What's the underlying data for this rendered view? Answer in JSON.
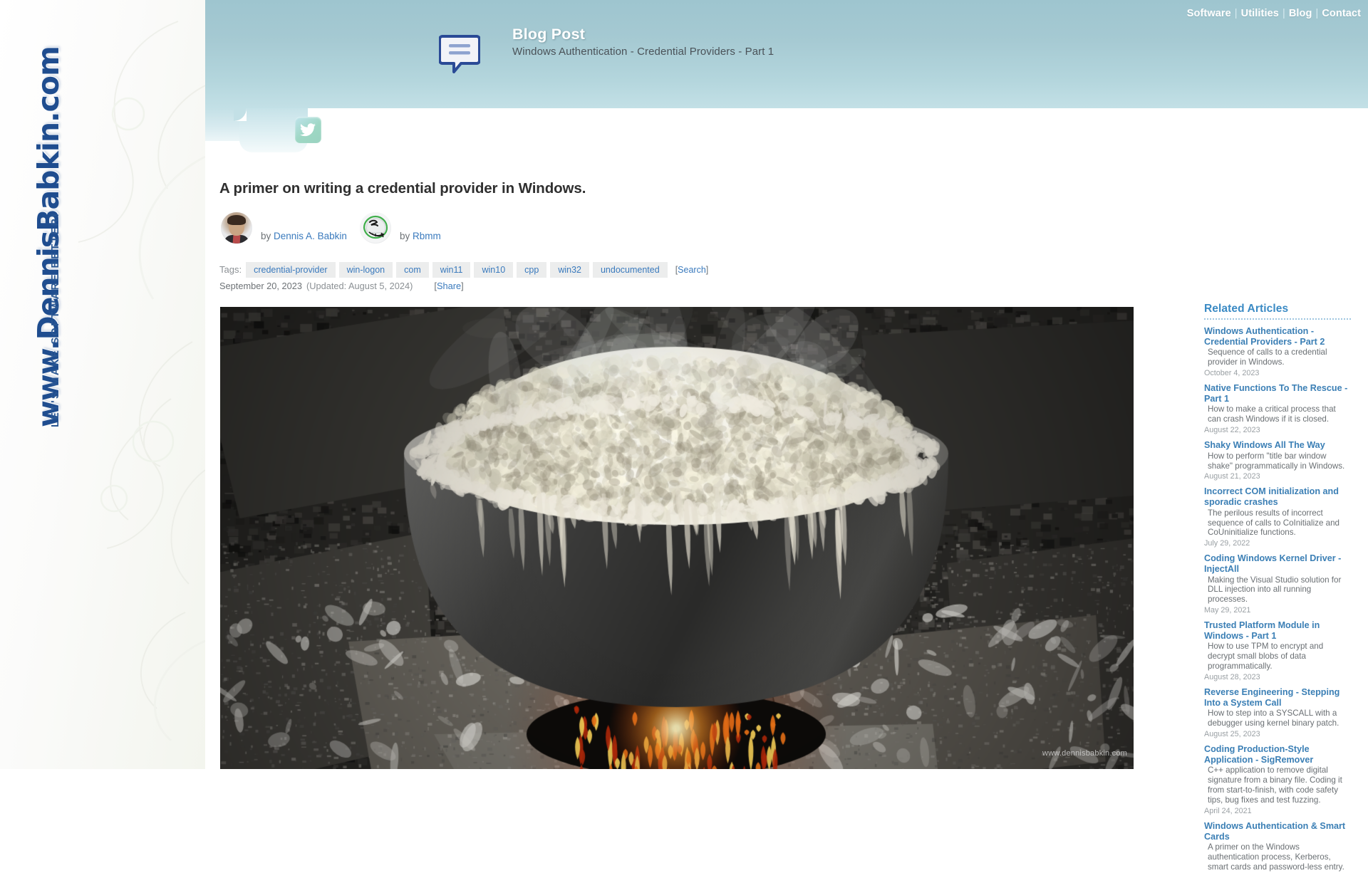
{
  "brand": {
    "url_text": "www.DennisBabkin.com",
    "tagline": "LET'S MAKE SOFTWARE BETTER!"
  },
  "nav": {
    "items": [
      {
        "label": "Software"
      },
      {
        "label": "Utilities"
      },
      {
        "label": "Blog"
      },
      {
        "label": "Contact"
      }
    ],
    "separator": "|"
  },
  "header": {
    "icon_name": "speech-bubble-icon",
    "title": "Blog Post",
    "subtitle": "Windows Authentication - Credential Providers - Part 1"
  },
  "tabs": {
    "twitter_icon_name": "twitter-bird-icon"
  },
  "article": {
    "title": "A primer on writing a credential provider in Windows.",
    "authors": [
      {
        "by_label": "by",
        "name": "Dennis A. Babkin",
        "avatar_name": "avatar-dennis-babkin"
      },
      {
        "by_label": "by",
        "name": "Rbmm",
        "avatar_name": "avatar-rbmm-helmet"
      }
    ],
    "tags_label": "Tags:",
    "tags": [
      "credential-provider",
      "win-logon",
      "com",
      "win11",
      "win10",
      "cpp",
      "win32",
      "undocumented"
    ],
    "search_link": "Search",
    "bracket_open": "[",
    "bracket_close": "]",
    "date": "September 20, 2023",
    "updated": "(Updated: August 5, 2024)",
    "share_label": "Share",
    "hero_watermark": "www.dennisbabkin.com",
    "hero_alt": "Large metal pot of boiling white porridge over an open fire on rocks"
  },
  "related": {
    "heading": "Related Articles",
    "items": [
      {
        "title": "Windows Authentication - Credential Providers - Part 2",
        "desc": "Sequence of calls to a credential provider in Windows.",
        "date": "October 4, 2023"
      },
      {
        "title": "Native Functions To The Rescue - Part 1",
        "desc": "How to make a critical process that can crash Windows if it is closed.",
        "date": "August 22, 2023"
      },
      {
        "title": "Shaky Windows All The Way",
        "desc": "How to perform \"title bar window shake\" programmatically in Windows.",
        "date": "August 21, 2023"
      },
      {
        "title": "Incorrect COM initialization and sporadic crashes",
        "desc": "The perilous results of incorrect sequence of calls to CoInitialize and CoUninitialize functions.",
        "date": "July 29, 2022"
      },
      {
        "title": "Coding Windows Kernel Driver - InjectAll",
        "desc": "Making the Visual Studio solution for DLL injection into all running processes.",
        "date": "May 29, 2021"
      },
      {
        "title": "Trusted Platform Module in Windows - Part 1",
        "desc": "How to use TPM to encrypt and decrypt small blobs of data programmatically.",
        "date": "August 28, 2023"
      },
      {
        "title": "Reverse Engineering - Stepping Into a System Call",
        "desc": "How to step into a SYSCALL with a debugger using kernel binary patch.",
        "date": "August 25, 2023"
      },
      {
        "title": "Coding Production-Style Application - SigRemover",
        "desc": "C++ application to remove digital signature from a binary file. Coding it from start-to-finish, with code safety tips, bug fixes and test fuzzing.",
        "date": "April 24, 2021"
      },
      {
        "title": "Windows Authentication & Smart Cards",
        "desc": "A primer on the Windows authentication process, Kerberos, smart cards and password-less entry.",
        "date": ""
      }
    ]
  },
  "colors": {
    "header_top": "#9ec5cf",
    "header_bottom": "#c3e0e6",
    "brand_blue": "#1f4d8f",
    "link_blue": "#3a7abd",
    "related_blue": "#3b7fb5",
    "tag_bg": "#eceded"
  }
}
